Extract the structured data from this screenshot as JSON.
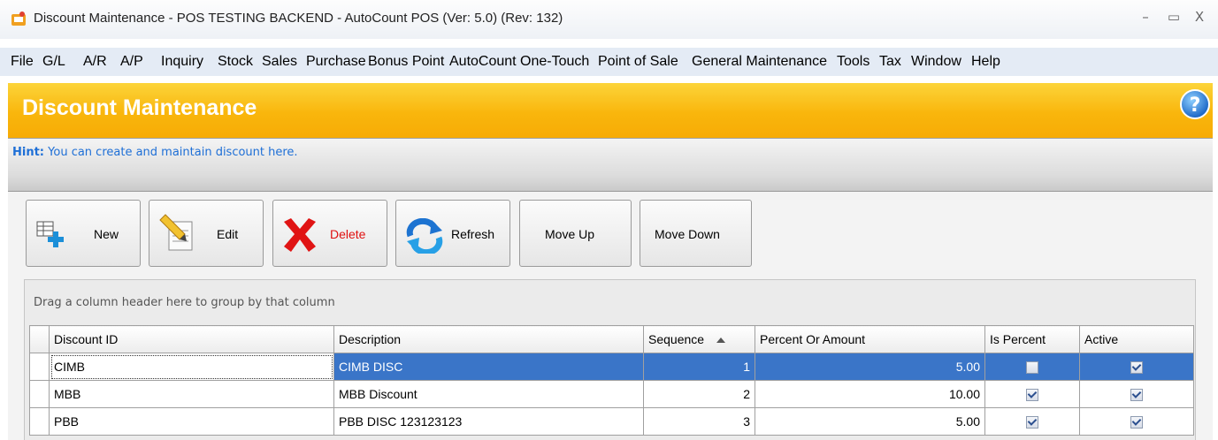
{
  "window": {
    "title": "Discount Maintenance - POS TESTING BACKEND - AutoCount POS (Ver: 5.0) (Rev: 132)",
    "minimize": "–",
    "maximize": "▭",
    "close": "X"
  },
  "menu": [
    "File",
    "G/L",
    "A/R",
    "A/P",
    "Inquiry",
    "Stock",
    "Sales",
    "Purchase",
    "Bonus Point",
    "AutoCount One-Touch",
    "Point of Sale",
    "General Maintenance",
    "Tools",
    "Tax",
    "Window",
    "Help"
  ],
  "banner": {
    "title": "Discount Maintenance"
  },
  "hint": {
    "label": "Hint:",
    "text": " You can create and maintain discount here."
  },
  "toolbar": {
    "new": "New",
    "edit": "Edit",
    "delete": "Delete",
    "refresh": "Refresh",
    "move_up": "Move Up",
    "move_down": "Move Down"
  },
  "grid": {
    "group_hint": "Drag a column header here to group by that column",
    "columns": [
      "Discount ID",
      "Description",
      "Sequence",
      "Percent Or Amount",
      "Is Percent",
      "Active"
    ],
    "rows": [
      {
        "id": "CIMB",
        "description": "CIMB DISC",
        "sequence": "1",
        "amount": "5.00",
        "is_percent": false,
        "active": true
      },
      {
        "id": "MBB",
        "description": "MBB Discount",
        "sequence": "2",
        "amount": "10.00",
        "is_percent": true,
        "active": true
      },
      {
        "id": "PBB",
        "description": "PBB DISC 123123123",
        "sequence": "3",
        "amount": "5.00",
        "is_percent": true,
        "active": true
      }
    ],
    "row_indicator": ">"
  },
  "colors": {
    "banner": "#f9b60c",
    "selection": "#3a75c8",
    "hint": "#1e6fd6",
    "delete_label": "#e01010"
  }
}
